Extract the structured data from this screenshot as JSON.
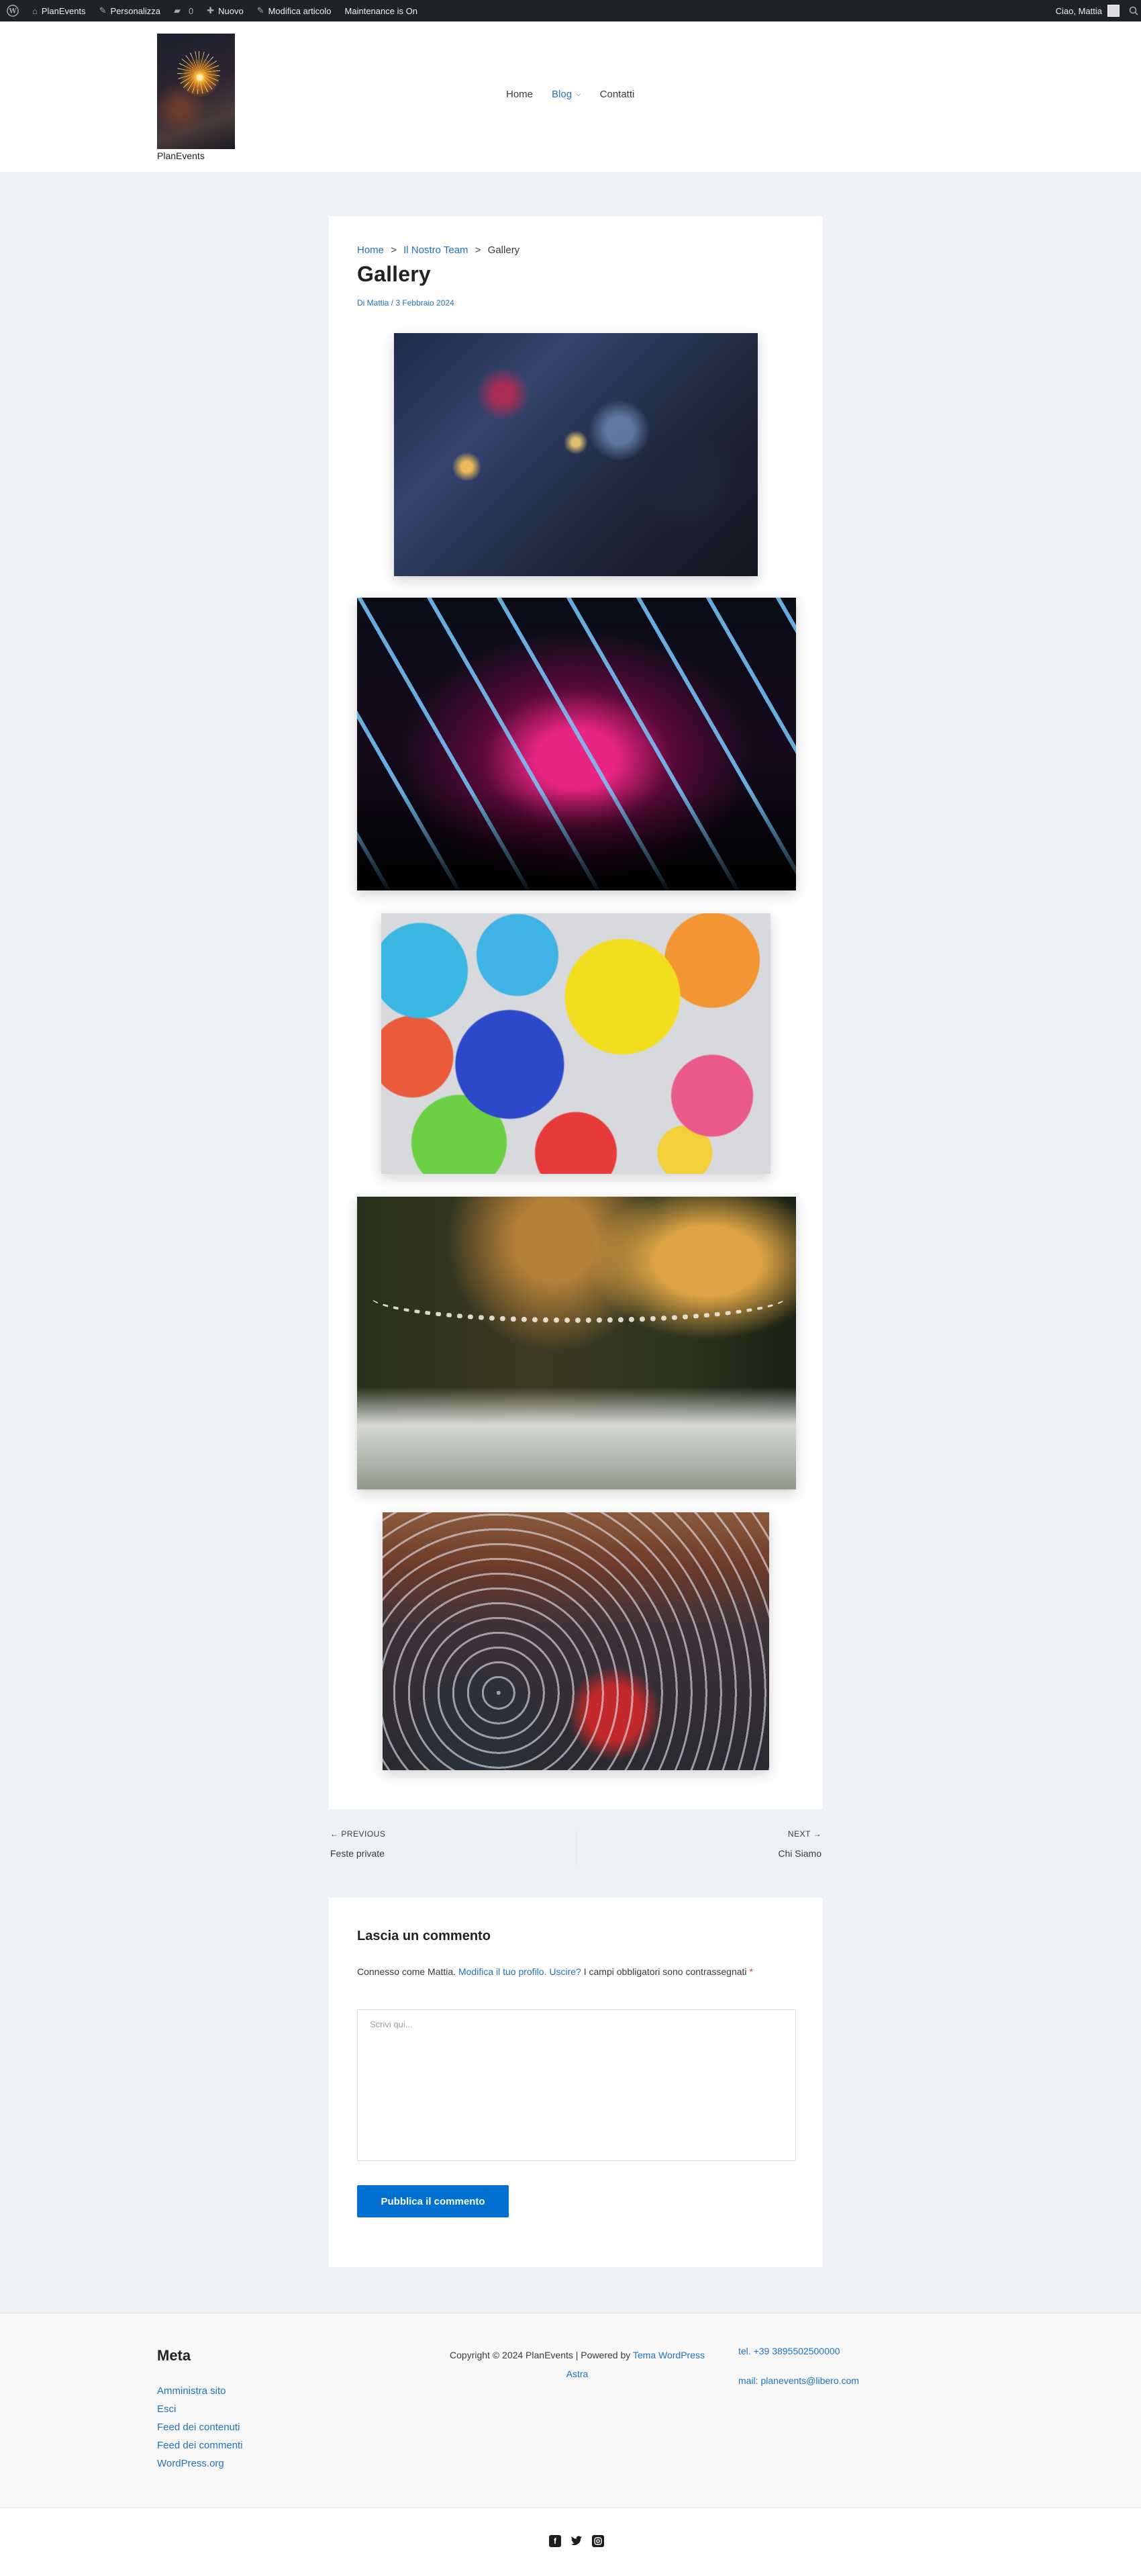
{
  "admin_bar": {
    "site_name": "PlanEvents",
    "customize": "Personalizza",
    "comments_count": "0",
    "new": "Nuovo",
    "edit": "Modifica articolo",
    "maintenance": "Maintenance is On",
    "greeting": "Ciao, Mattia"
  },
  "header": {
    "site_title": "PlanEvents",
    "nav": [
      {
        "label": "Home"
      },
      {
        "label": "Blog"
      },
      {
        "label": "Contatti"
      }
    ]
  },
  "article": {
    "breadcrumb": [
      "Home",
      "Il Nostro Team",
      "Gallery"
    ],
    "breadcrumb_sep": ">",
    "title": "Gallery",
    "meta": "Di Mattia / 3 Febbraio 2024",
    "images": [
      "table-dinner-photo",
      "neon-tunnel-party-photo",
      "balloons-photo",
      "tree-garland-garden-photo",
      "crowd-party-photo"
    ]
  },
  "post_nav": {
    "previous_label": "← PREVIOUS",
    "previous_title": "Feste private",
    "next_label": "NEXT →",
    "next_title": "Chi Siamo"
  },
  "comments": {
    "title": "Lascia un commento",
    "logged_in_prefix": "Connesso come Mattia.",
    "edit_profile": "Modifica il tuo profilo.",
    "logout": "Uscire?",
    "required_text": "I campi obbligatori sono contrassegnati",
    "required_mark": "*",
    "placeholder": "Scrivi qui...",
    "submit": "Pubblica il commento"
  },
  "footer": {
    "meta_title": "Meta",
    "meta_links": [
      "Amministra sito",
      "Esci",
      "Feed dei contenuti",
      "Feed dei commenti",
      "WordPress.org"
    ],
    "copyright": "Copyright © 2024 PlanEvents | Powered by",
    "theme_link": "Tema WordPress Astra",
    "phone": "tel. +39 3895502500000",
    "email": "mail: planevents@libero.com",
    "social": [
      "facebook-icon",
      "twitter-icon",
      "instagram-icon"
    ]
  }
}
